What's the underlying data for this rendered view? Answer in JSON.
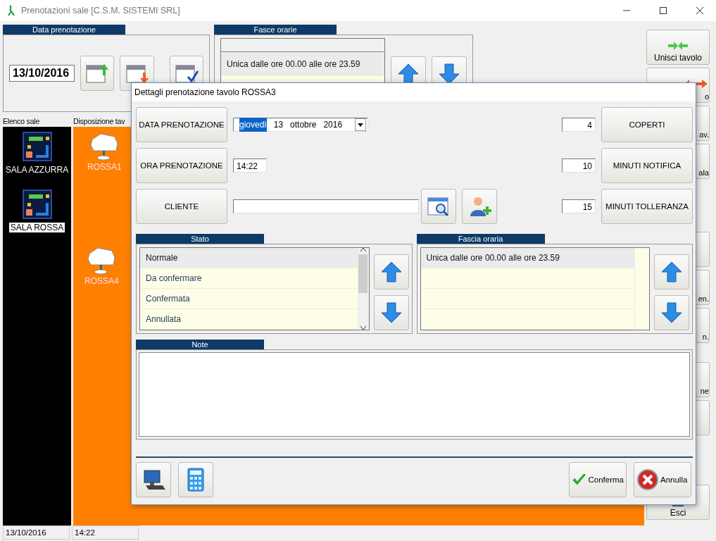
{
  "window": {
    "title": "Prenotazioni sale [C.S.M. SISTEMI SRL]"
  },
  "data_prenotazione": {
    "heading": "Data prenotazione",
    "date": "13/10/2016"
  },
  "fasce_orarie": {
    "heading": "Fasce orarie",
    "rows": [
      {
        "text": "Unica dalle ore 00.00 alle ore 23.59",
        "selected": true
      }
    ]
  },
  "sidebar": {
    "heading": "Elenco sale",
    "items": [
      {
        "label": "SALA AZZURRA",
        "selected": false
      },
      {
        "label": "SALA ROSSA",
        "selected": true
      }
    ]
  },
  "layout": {
    "heading": "Disposizione tav",
    "tables": [
      {
        "label": "ROSSA1",
        "kind": "table"
      },
      {
        "label": "ROSSA4",
        "kind": "table"
      }
    ]
  },
  "right_buttons": [
    {
      "label": "Unisci tavolo",
      "kind": "full"
    },
    {
      "label": "o",
      "kind": "cut"
    },
    {
      "label": "av.",
      "kind": "cut"
    },
    {
      "label": "ala",
      "kind": "cut"
    },
    {
      "kind": "blank"
    },
    {
      "label": "en.",
      "kind": "cut"
    },
    {
      "label": "n.",
      "kind": "cut"
    },
    {
      "label": "ne",
      "kind": "cut"
    },
    {
      "kind": "blank"
    },
    {
      "label": "Esci",
      "kind": "full"
    }
  ],
  "status_bar": [
    "13/10/2016",
    "14:22"
  ],
  "dialog": {
    "title": "Dettagli prenotazione tavolo ROSSA3",
    "date_button": "DATA PRENOTAZIONE",
    "date_combo": [
      {
        "text": "giovedì",
        "selected": true
      },
      {
        "text": "13",
        "selected": false
      },
      {
        "text": "ottobre",
        "selected": false
      },
      {
        "text": "2016",
        "selected": false
      }
    ],
    "time_button": "ORA PRENOTAZIONE",
    "time": "14:22",
    "client_button": "CLIENTE",
    "coperti": {
      "value": "4",
      "label": "COPERTI"
    },
    "notifica": {
      "value": "10",
      "label": "MINUTI NOTIFICA"
    },
    "tolleranza": {
      "value": "15",
      "label": "MINUTI TOLLERANZA"
    },
    "stato": {
      "heading": "Stato",
      "rows": [
        {
          "text": "Normale",
          "selected": true
        },
        {
          "text": "Da confermare",
          "selected": false
        },
        {
          "text": "Confermata",
          "selected": false
        },
        {
          "text": "Annullata",
          "selected": false
        }
      ]
    },
    "fascia": {
      "heading": "Fascia oraria",
      "rows": [
        {
          "text": "Unica dalle ore 00.00 alle ore 23.59",
          "selected": true
        }
      ]
    },
    "note": {
      "heading": "Note"
    },
    "confirm": "Conferma",
    "cancel": "Annulla"
  }
}
